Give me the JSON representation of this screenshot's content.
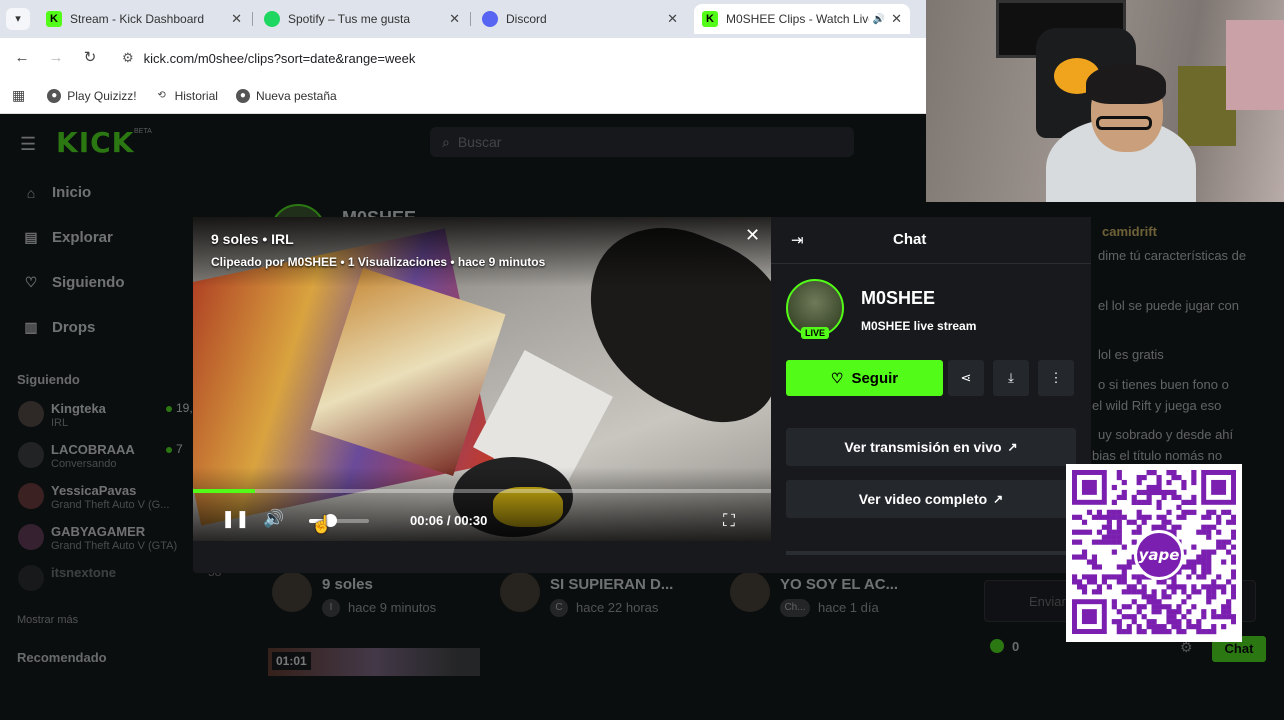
{
  "browser": {
    "tabs": [
      {
        "title": "Stream - Kick Dashboard",
        "favicon": "kick-icon"
      },
      {
        "title": "Spotify – Tus me gusta",
        "favicon": "spotify-icon"
      },
      {
        "title": "Discord",
        "favicon": "discord-icon"
      },
      {
        "title": "M0SHEE Clips - Watch Live",
        "favicon": "kick-icon",
        "active": true
      }
    ],
    "url": "kick.com/m0shee/clips?sort=date&range=week",
    "bookmarks": [
      "Play Quizizz!",
      "Historial",
      "Nueva pestaña"
    ]
  },
  "kick": {
    "search_placeholder": "Buscar",
    "nav": [
      "Inicio",
      "Explorar",
      "Siguiendo",
      "Drops"
    ],
    "following_heading": "Siguiendo",
    "channels": [
      {
        "name": "Kingteka",
        "sub": "IRL",
        "viewers": "19,"
      },
      {
        "name": "LACOBRAAA",
        "sub": "Conversando",
        "viewers": "7"
      },
      {
        "name": "YessicaPavas",
        "sub": "Grand Theft Auto V (G...",
        "viewers": ""
      },
      {
        "name": "GABYAGAMER",
        "sub": "Grand Theft Auto V (GTA)",
        "viewers": ""
      },
      {
        "name": "itsnextone",
        "sub": "",
        "viewers": "58"
      }
    ],
    "show_more": "Mostrar más",
    "recommended_heading": "Recomendado",
    "profile_name": "M0SHEE",
    "clips": [
      {
        "title": "9 soles",
        "badge": "I",
        "time": "hace 9 minutos"
      },
      {
        "title": "SI SUPIERAN D...",
        "badge": "C",
        "time": "hace 22 horas"
      },
      {
        "title": "YO SOY EL AC...",
        "badge": "Ch...",
        "time": "hace 1 día"
      }
    ],
    "thumb_duration": "01:01"
  },
  "modal": {
    "clip_title": "9 soles • IRL",
    "clip_meta": "Clipeado por M0SHEE • 1 Visualizaciones • hace 9 minutos",
    "time": "00:06 / 00:30",
    "progress": 0.2,
    "volume": 0.35,
    "panel_title": "Chat",
    "channel_name": "M0SHEE",
    "channel_sub": "M0SHEE live stream",
    "live_label": "LIVE",
    "follow_label": "Seguir",
    "watch_live_label": "Ver transmisión en vivo",
    "watch_full_label": "Ver video completo"
  },
  "chat": {
    "username": "camidrift",
    "lines": [
      "dime tú características de",
      "el lol se puede jugar con",
      "lol es gratis",
      "o si tienes buen fono o",
      "el wild Rift y juega eso",
      "uy sobrado y desde ahí",
      "bias el título nomás no"
    ],
    "input_placeholder": "Enviar",
    "points": "0",
    "send_label": "Chat"
  },
  "overlays": {
    "qr_logo_text": "yape"
  },
  "colors": {
    "kick_green": "#53fc18",
    "yape_purple": "#7a1fb0"
  }
}
